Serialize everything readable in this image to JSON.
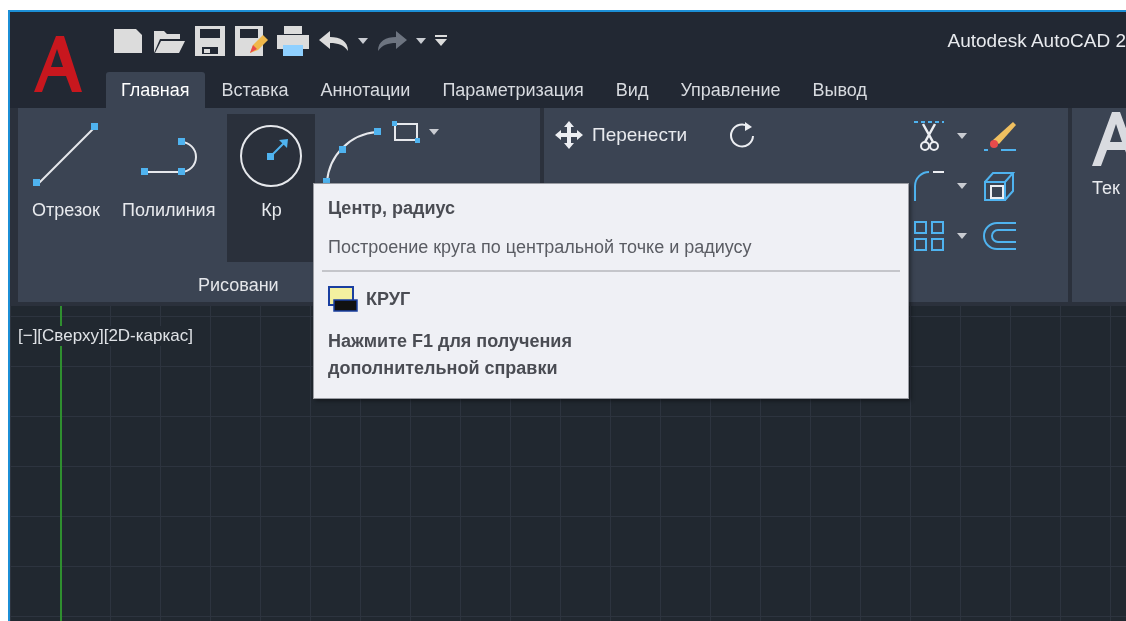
{
  "app": {
    "title": "Autodesk AutoCAD 2"
  },
  "tabs": [
    {
      "label": "Главная",
      "selected": true
    },
    {
      "label": "Вставка",
      "selected": false
    },
    {
      "label": "Аннотации",
      "selected": false
    },
    {
      "label": "Параметризация",
      "selected": false
    },
    {
      "label": "Вид",
      "selected": false
    },
    {
      "label": "Управление",
      "selected": false
    },
    {
      "label": "Вывод",
      "selected": false
    }
  ],
  "ribbon": {
    "draw_panel": {
      "title": "Рисовани",
      "tools": [
        {
          "label": "Отрезок",
          "kind": "line",
          "highlighted": false
        },
        {
          "label": "Полилиния",
          "kind": "polyline",
          "highlighted": false
        },
        {
          "label": "Кр",
          "kind": "circle",
          "highlighted": true
        }
      ]
    },
    "modify_panel": {
      "move_label": "Перенести"
    },
    "annotation_panel": {
      "label": "Тек"
    }
  },
  "viewport": {
    "label": "[−][Сверху][2D-каркас]"
  },
  "tooltip": {
    "title": "Центр, радиус",
    "description": "Построение круга по центральной точке и радиусу",
    "command": "КРУГ",
    "help": "Нажмите F1 для получения дополнительной справки"
  }
}
